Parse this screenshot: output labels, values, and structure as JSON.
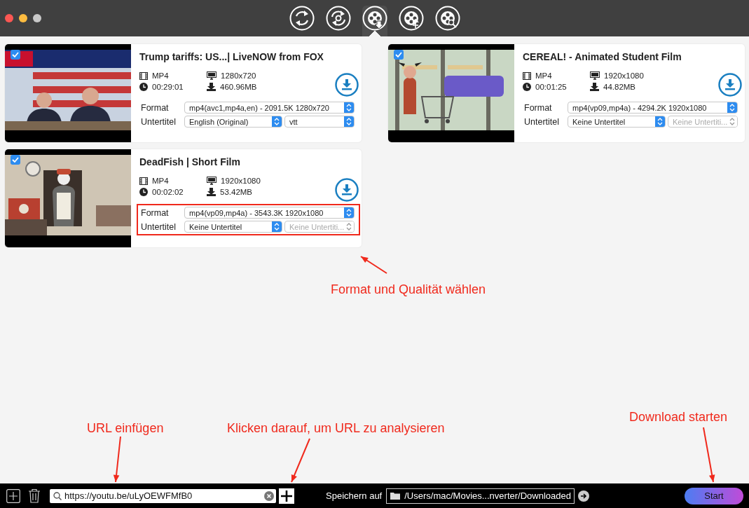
{
  "toolbar": [
    {
      "selected": false
    },
    {
      "selected": false
    },
    {
      "selected": true
    },
    {
      "selected": false
    },
    {
      "selected": false
    }
  ],
  "videos": [
    {
      "checked": true,
      "title": "Trump tariffs: US...| LiveNOW from FOX",
      "container": "MP4",
      "resolution": "1280x720",
      "duration": "00:29:01",
      "size": "460.96MB",
      "format_label": "Format",
      "format": "mp4(avc1,mp4a,en) - 2091.5K 1280x720",
      "subtitle_label": "Untertitel",
      "subtitle": "English (Original)",
      "subtitle_format": "vtt",
      "subtitle_format_disabled": false,
      "highlighted": false
    },
    {
      "checked": true,
      "title": "CEREAL! - Animated Student Film",
      "container": "MP4",
      "resolution": "1920x1080",
      "duration": "00:01:25",
      "size": "44.82MB",
      "format_label": "Format",
      "format": "mp4(vp09,mp4a) - 4294.2K 1920x1080",
      "subtitle_label": "Untertitel",
      "subtitle": "Keine Untertitel",
      "subtitle_format": "Keine Untertiti...",
      "subtitle_format_disabled": true,
      "highlighted": false
    },
    {
      "checked": true,
      "title": "DeadFish | Short Film",
      "container": "MP4",
      "resolution": "1920x1080",
      "duration": "00:02:02",
      "size": "53.42MB",
      "format_label": "Format",
      "format": "mp4(vp09,mp4a) - 3543.3K 1920x1080",
      "subtitle_label": "Untertitel",
      "subtitle": "Keine Untertitel",
      "subtitle_format": "Keine Untertiti...",
      "subtitle_format_disabled": true,
      "highlighted": true
    }
  ],
  "bottom_bar": {
    "url": "https://youtu.be/uLyOEWFMfB0",
    "save_label": "Speichern auf",
    "save_path": "/Users/mac/Movies...nverter/Downloaded",
    "start": "Start"
  },
  "annotations": [
    {
      "text": "Format und Qualität wählen"
    },
    {
      "text": "URL einfügen"
    },
    {
      "text": "Klicken darauf, um URL zu analysieren"
    },
    {
      "text": "Download starten"
    }
  ]
}
